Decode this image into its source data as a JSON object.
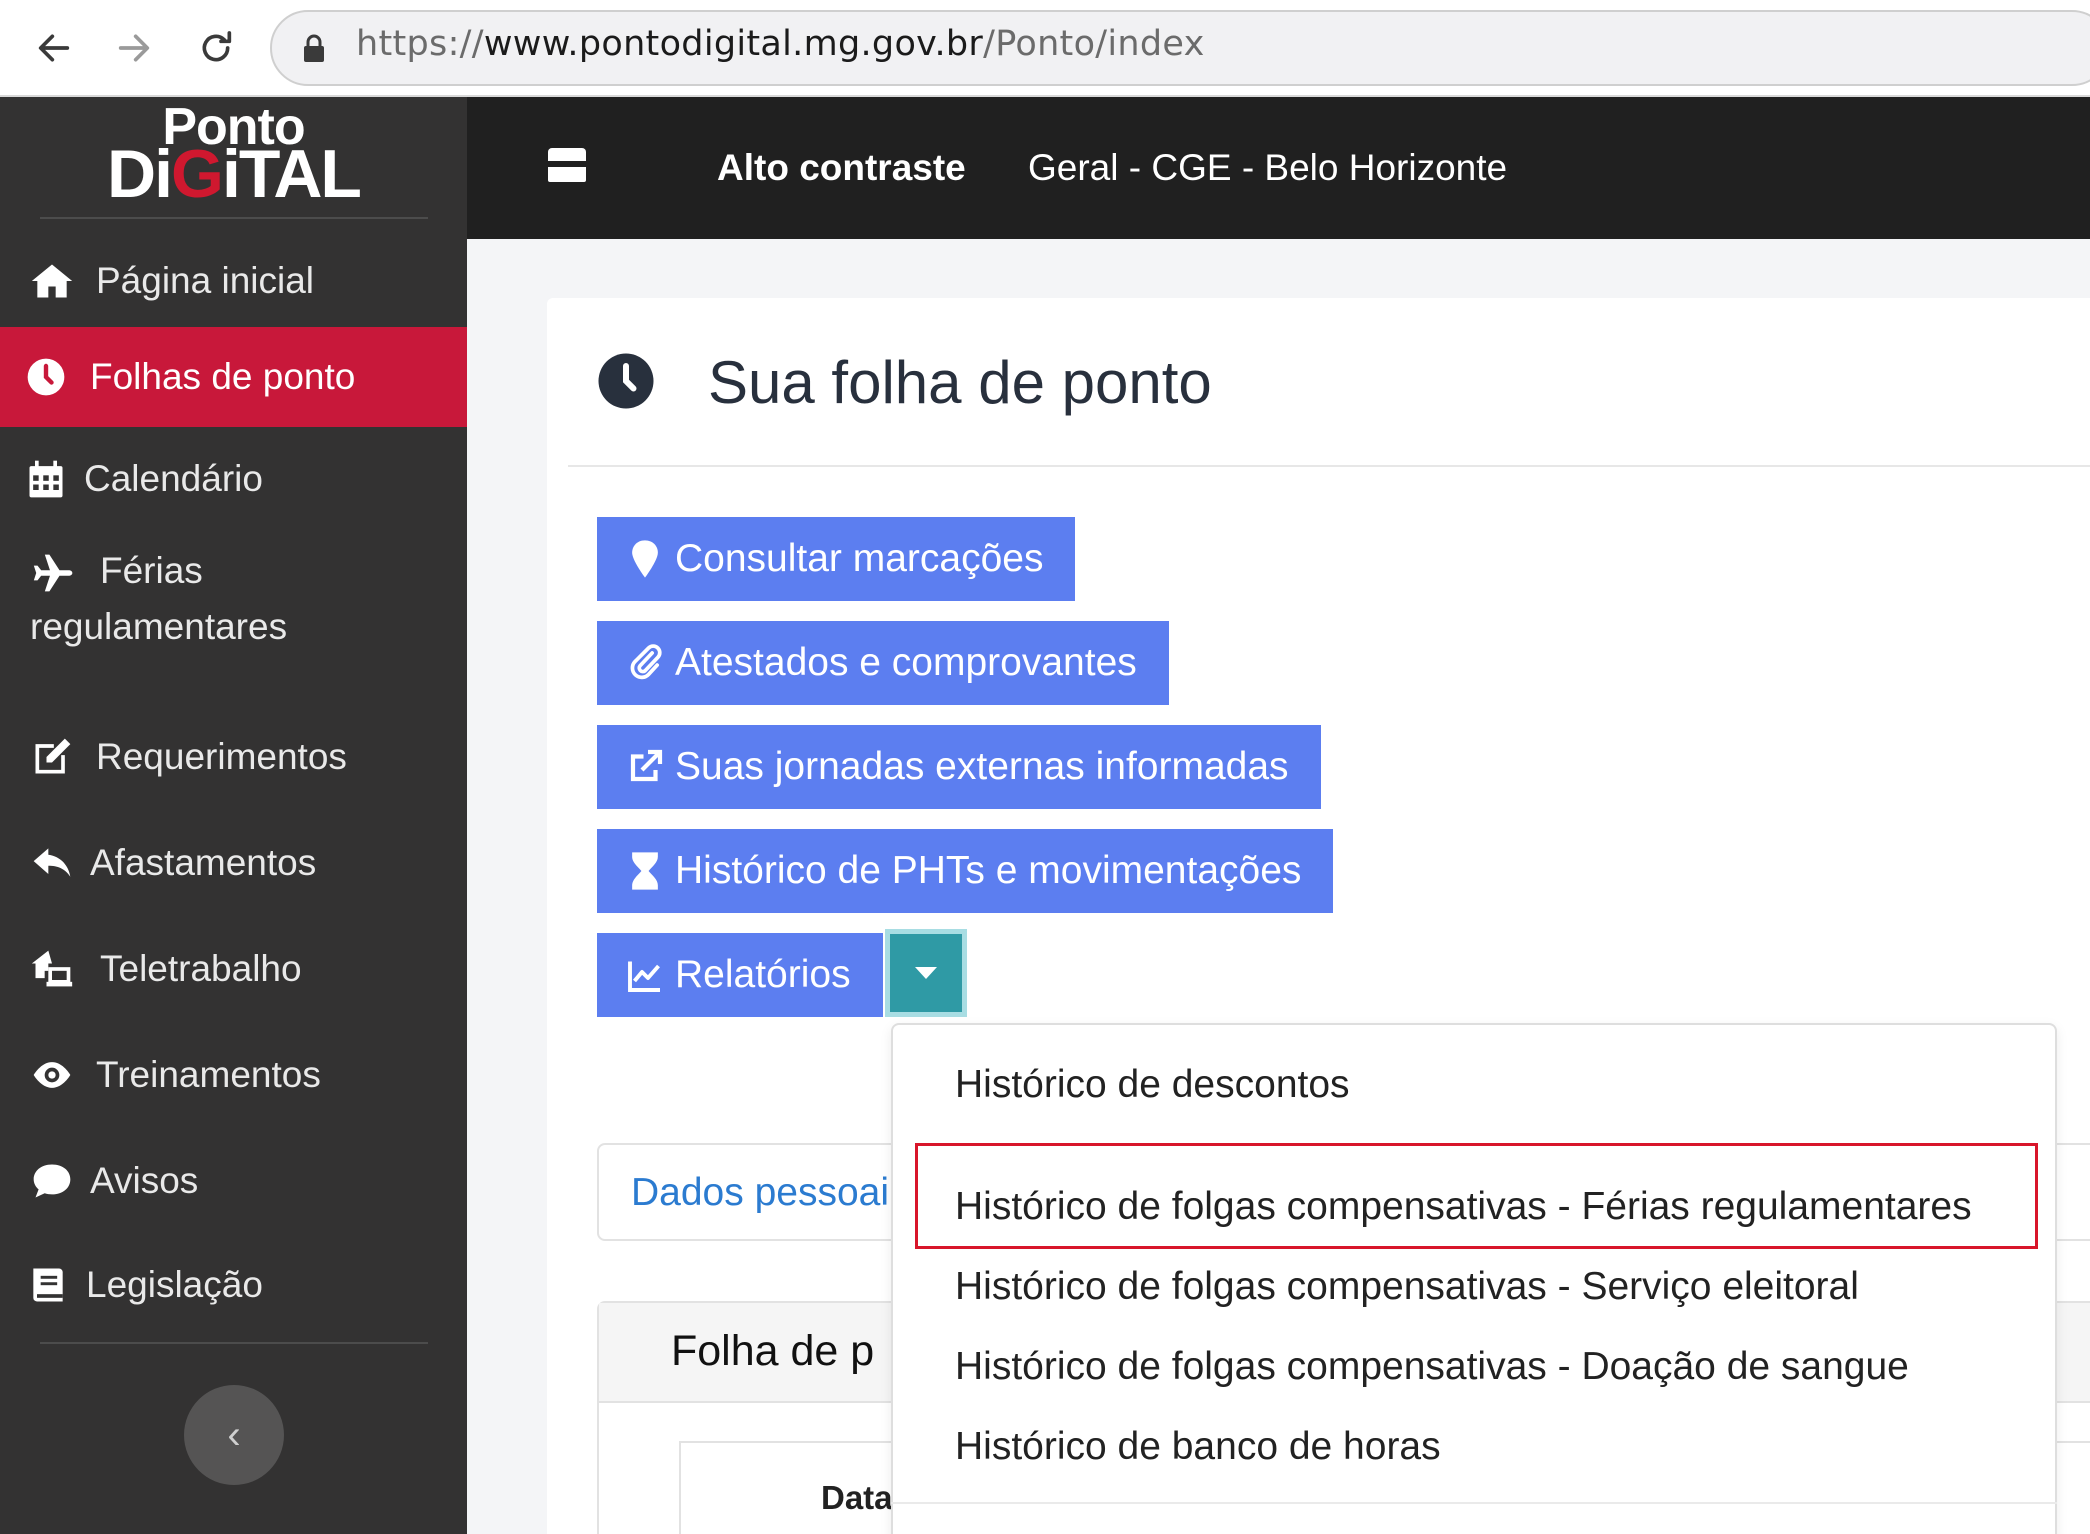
{
  "browser": {
    "url_prefix": "https://",
    "url_host": "www.pontodigital.mg.gov.br",
    "url_path": "/Ponto/index"
  },
  "logo": {
    "top": "Ponto",
    "bottom_a": "Di",
    "bottom_b": "G",
    "bottom_c": "iTAL"
  },
  "sidebar": {
    "items": [
      {
        "label": "Página inicial",
        "icon": "home-icon"
      },
      {
        "label": "Folhas de ponto",
        "icon": "clock-icon",
        "active": true
      },
      {
        "label": "Calendário",
        "icon": "calendar-icon"
      },
      {
        "label_line1": "Férias",
        "label_line2": "regulamentares",
        "icon": "plane-icon"
      },
      {
        "label": "Requerimentos",
        "icon": "edit-icon"
      },
      {
        "label": "Afastamentos",
        "icon": "reply-icon"
      },
      {
        "label": "Teletrabalho",
        "icon": "home-laptop-icon"
      },
      {
        "label": "Treinamentos",
        "icon": "eye-icon"
      },
      {
        "label": "Avisos",
        "icon": "chat-icon"
      },
      {
        "label": "Legislação",
        "icon": "book-icon"
      }
    ],
    "collapse_glyph": "‹"
  },
  "header": {
    "contrast_label": "Alto contraste",
    "org_label": "Geral - CGE - Belo Horizonte"
  },
  "main": {
    "title": "Sua folha de ponto",
    "buttons": [
      {
        "label": "Consultar marcações",
        "icon": "map-marker-icon"
      },
      {
        "label": "Atestados e comprovantes",
        "icon": "paperclip-icon"
      },
      {
        "label": "Suas jornadas externas informadas",
        "icon": "external-link-icon"
      },
      {
        "label": "Histórico de PHTs e movimentações",
        "icon": "hourglass-icon"
      },
      {
        "label": "Relatórios",
        "icon": "line-chart-icon"
      }
    ],
    "panel_dados": "Dados pessoai",
    "panel_folha": "Folha de p",
    "table_header": "Data"
  },
  "dropdown": {
    "items": [
      "Histórico de descontos",
      "Histórico de folgas compensativas - Férias regulamentares",
      "Histórico de folgas compensativas - Serviço eleitoral",
      "Histórico de folgas compensativas - Doação de sangue",
      "Histórico de banco de horas"
    ]
  },
  "colors": {
    "sidebar_bg": "#333232",
    "active_item": "#c8183a",
    "button_blue": "#5c7ef0",
    "caret_teal": "#2f9aa5",
    "highlight_red": "#d8162a"
  }
}
